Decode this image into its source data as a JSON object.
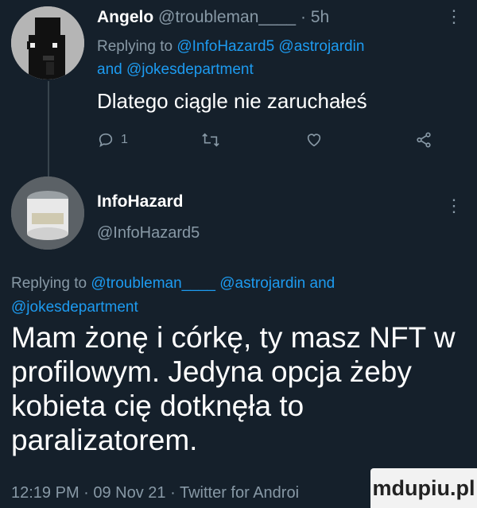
{
  "reply_tweet": {
    "display_name": "Angelo",
    "handle": "@troubleman____",
    "separator": "·",
    "time": "5h",
    "replying_prefix": "Replying to",
    "replying_mentions": "@InfoHazard5 @astrojardin",
    "replying_and": "and",
    "replying_last": "@jokesdepartment",
    "text": "Dlatego ciągle nie zaruchałeś",
    "reply_count": "1"
  },
  "main_tweet": {
    "display_name": "InfoHazard",
    "handle": "@InfoHazard5",
    "replying_prefix": "Replying to",
    "replying_mentions": "@troubleman____ @astrojardin",
    "replying_and": "and",
    "replying_last": "@jokesdepartment",
    "text": "Mam żonę i córkę, ty masz NFT w profilowym. Jedyna opcja żeby kobieta cię dotknęła to paralizatorem.",
    "meta": "12:19 PM · 09 Nov 21 · Twitter for Androi"
  },
  "watermark": "mdupiu.pl",
  "icons": [
    "reply-icon",
    "retweet-icon",
    "like-icon",
    "share-icon",
    "more-icon"
  ],
  "colors": {
    "background": "#15202b",
    "link": "#1d9bf0",
    "muted": "#8899a6"
  }
}
